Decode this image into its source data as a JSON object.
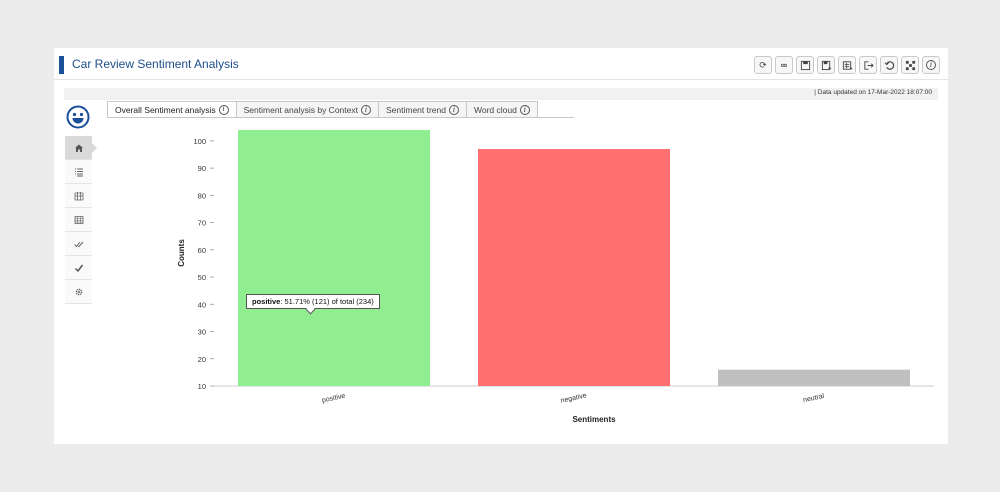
{
  "header": {
    "title": "Car Review Sentiment Analysis",
    "accent_color": "#1a4f9a",
    "toolbar": [
      {
        "icon": "refresh-icon"
      },
      {
        "icon": "link-icon"
      },
      {
        "icon": "save-icon"
      },
      {
        "icon": "save-as-icon"
      },
      {
        "icon": "export-icon"
      },
      {
        "icon": "logout-icon"
      },
      {
        "icon": "reset-icon"
      },
      {
        "icon": "grid-icon"
      },
      {
        "icon": "info-icon"
      }
    ]
  },
  "status": {
    "text": "|   Data updated on 17-Mar-2022 18:07:00"
  },
  "sidebar": {
    "items": [
      {
        "icon": "home-icon",
        "active": true
      },
      {
        "icon": "list-icon"
      },
      {
        "icon": "calendar-grid-icon"
      },
      {
        "icon": "table-icon"
      },
      {
        "icon": "double-check-icon"
      },
      {
        "icon": "check-icon"
      },
      {
        "icon": "settings-icon"
      }
    ]
  },
  "tabs": [
    {
      "label": "Overall Sentiment analysis",
      "active": true
    },
    {
      "label": "Sentiment analysis by Context"
    },
    {
      "label": "Sentiment trend"
    },
    {
      "label": "Word cloud"
    }
  ],
  "tooltip": {
    "label": "positive",
    "text": ": 51.71% (121) of total (234)"
  },
  "chart_data": {
    "type": "bar",
    "categories": [
      "positive",
      "negative",
      "neutral"
    ],
    "values": [
      121,
      97,
      16
    ],
    "colors": [
      "#90ee90",
      "#ff6f6f",
      "#c0c0c0"
    ],
    "xlabel": "Sentiments",
    "ylabel": "Counts",
    "ylim": [
      10,
      104
    ],
    "yticks": [
      10,
      20,
      30,
      40,
      50,
      60,
      70,
      80,
      90,
      100
    ],
    "grid": false,
    "legend": "none"
  }
}
